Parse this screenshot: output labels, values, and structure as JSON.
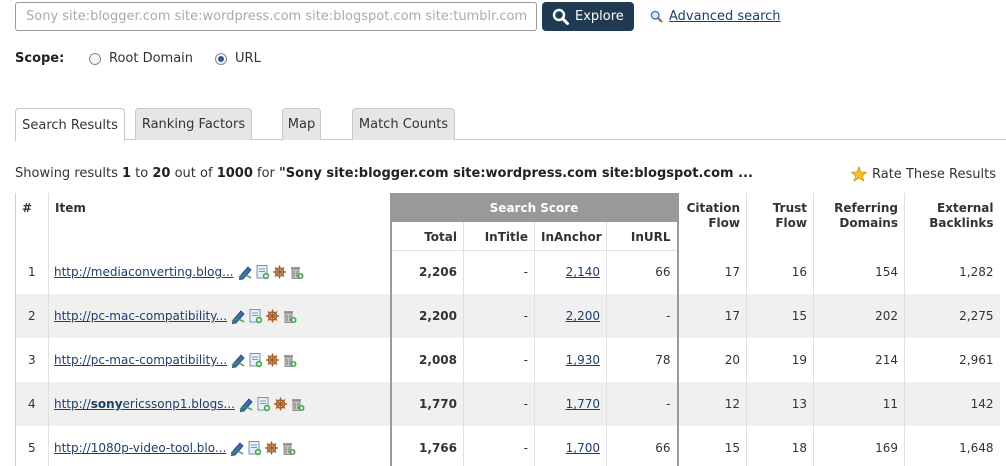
{
  "search": {
    "placeholder": "Sony site:blogger.com site:wordpress.com site:blogspot.com site:tumblr.com",
    "explore_label": "Explore",
    "advanced_label": "Advanced search"
  },
  "scope": {
    "label": "Scope:",
    "options": [
      {
        "label": "Root Domain",
        "selected": false
      },
      {
        "label": "URL",
        "selected": true
      }
    ]
  },
  "tabs": [
    {
      "label": "Search Results",
      "active": true
    },
    {
      "label": "Ranking Factors",
      "active": false
    },
    {
      "label": "Map",
      "active": false
    },
    {
      "label": "Match Counts",
      "active": false
    }
  ],
  "summary": {
    "prefix": "Showing results ",
    "from": "1",
    "to_word": " to ",
    "to": "20",
    "outof_word": " out of ",
    "total": "1000",
    "for_word": " for ",
    "query": "\"Sony site:blogger.com site:wordpress.com site:blogspot.com ...",
    "rate_label": "Rate These Results"
  },
  "table": {
    "headers": {
      "num": "#",
      "item": "Item",
      "search_score": "Search Score",
      "total": "Total",
      "intitle": "InTitle",
      "inanchor": "InAnchor",
      "inurl": "InURL",
      "citation_flow_1": "Citation",
      "citation_flow_2": "Flow",
      "trust_flow_1": "Trust",
      "trust_flow_2": "Flow",
      "ref_domains_1": "Referring",
      "ref_domains_2": "Domains",
      "ext_backlinks_1": "External",
      "ext_backlinks_2": "Backlinks"
    },
    "rows": [
      {
        "num": "1",
        "url_pre": "http://mediaconverting.blog...",
        "url_bold": "",
        "url_post": "",
        "total": "2,206",
        "intitle": "-",
        "inanchor": "2,140",
        "inurl": "66",
        "cf": "17",
        "tf": "16",
        "rd": "154",
        "eb": "1,282"
      },
      {
        "num": "2",
        "url_pre": "http://pc-mac-compatibility...",
        "url_bold": "",
        "url_post": "",
        "total": "2,200",
        "intitle": "-",
        "inanchor": "2,200",
        "inurl": "-",
        "cf": "17",
        "tf": "15",
        "rd": "202",
        "eb": "2,275"
      },
      {
        "num": "3",
        "url_pre": "http://pc-mac-compatibility...",
        "url_bold": "",
        "url_post": "",
        "total": "2,008",
        "intitle": "-",
        "inanchor": "1,930",
        "inurl": "78",
        "cf": "20",
        "tf": "19",
        "rd": "214",
        "eb": "2,961"
      },
      {
        "num": "4",
        "url_pre": "http://",
        "url_bold": "sony",
        "url_post": "ericssonp1.blogs...",
        "total": "1,770",
        "intitle": "-",
        "inanchor": "1,770",
        "inurl": "-",
        "cf": "12",
        "tf": "13",
        "rd": "11",
        "eb": "142"
      },
      {
        "num": "5",
        "url_pre": "http://1080p-video-tool.blo...",
        "url_bold": "",
        "url_post": "",
        "total": "1,766",
        "intitle": "-",
        "inanchor": "1,700",
        "inurl": "66",
        "cf": "15",
        "tf": "18",
        "rd": "169",
        "eb": "1,648"
      }
    ]
  }
}
